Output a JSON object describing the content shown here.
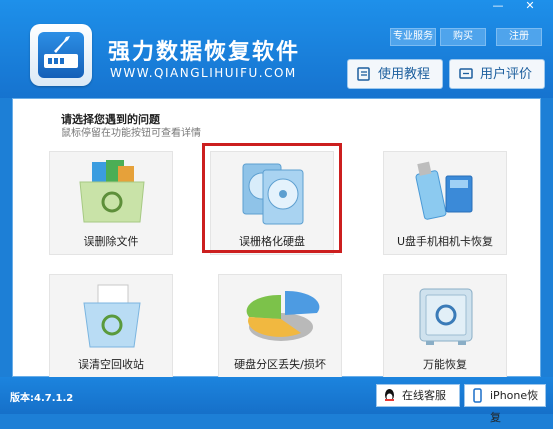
{
  "header": {
    "title": "强力数据恢复软件",
    "url": "WWW.QIANGLIHUIFU.COM",
    "top_links": [
      "专业服务",
      "购买",
      "注册"
    ],
    "tutorial_label": "使用教程",
    "review_label": "用户评价"
  },
  "window_controls": {
    "minimize": "—",
    "close": "✕"
  },
  "main": {
    "prompt": "请选择您遇到的问题",
    "hint": "鼠标停留在功能按钮可查看详情",
    "tiles": [
      {
        "label": "误删除文件",
        "icon": "folder-recycle-icon"
      },
      {
        "label": "误栅格化硬盘",
        "icon": "hard-disk-icon",
        "selected": true
      },
      {
        "label": "U盘手机相机卡恢复",
        "icon": "usb-sd-card-icon"
      },
      {
        "label": "误清空回收站",
        "icon": "recycle-bin-icon"
      },
      {
        "label": "硬盘分区丢失/损坏",
        "icon": "pie-partition-icon"
      },
      {
        "label": "万能恢复",
        "icon": "safe-box-icon"
      }
    ]
  },
  "footer": {
    "version": "版本:4.7.1.2",
    "online_service": "在线客服",
    "iphone_recovery": "iPhone恢复"
  },
  "colors": {
    "accent": "#1d7fd6",
    "selection": "#cc1f1f"
  }
}
